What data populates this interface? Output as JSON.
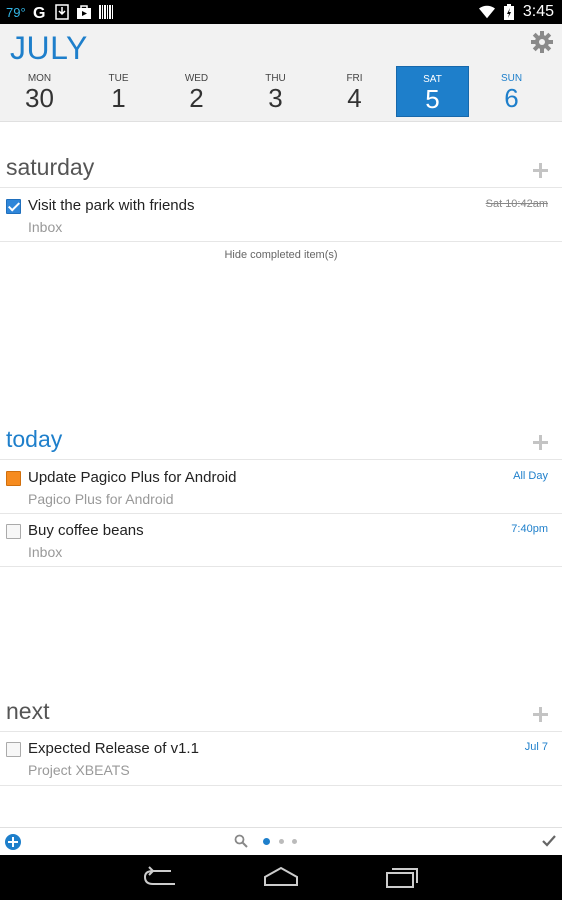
{
  "status_bar": {
    "temperature": "79°",
    "time": "3:45",
    "icons": [
      "google-icon",
      "download-icon",
      "shop-icon",
      "barcode-icon",
      "wifi-icon",
      "battery-icon"
    ]
  },
  "header": {
    "month": "JULY",
    "week": [
      {
        "day": "MON",
        "date": "30"
      },
      {
        "day": "TUE",
        "date": "1"
      },
      {
        "day": "WED",
        "date": "2"
      },
      {
        "day": "THU",
        "date": "3"
      },
      {
        "day": "FRI",
        "date": "4"
      },
      {
        "day": "SAT",
        "date": "5",
        "selected": true
      },
      {
        "day": "SUN",
        "date": "6"
      }
    ]
  },
  "sections": {
    "saturday": {
      "title": "saturday",
      "tasks": [
        {
          "title": "Visit the park with friends",
          "project": "Inbox",
          "time": "Sat 10:42am",
          "completed": true
        }
      ],
      "hide_completed": "Hide completed item(s)"
    },
    "today": {
      "title": "today",
      "tasks": [
        {
          "title": "Update Pagico Plus for Android",
          "project": "Pagico Plus for Android",
          "time": "All Day",
          "color": "#f68b1f"
        },
        {
          "title": "Buy coffee beans",
          "project": "Inbox",
          "time": "7:40pm"
        }
      ]
    },
    "next": {
      "title": "next",
      "tasks": [
        {
          "title": "Expected Release of v1.1",
          "project": "Project XBEATS",
          "time": "Jul 7"
        }
      ]
    }
  },
  "colors": {
    "accent": "#1e7fcb",
    "project_orange": "#f68b1f"
  }
}
